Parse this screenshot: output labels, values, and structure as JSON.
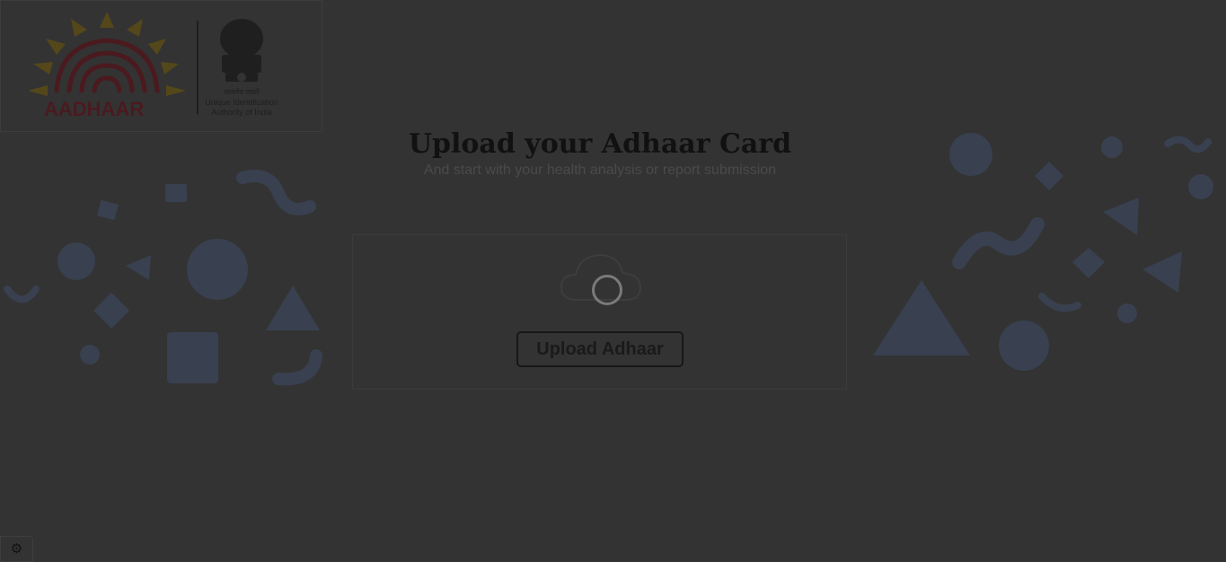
{
  "logo": {
    "brand_text": "AADHAAR",
    "emblem_hindi": "सत्यमेव जयते",
    "authority_line1": "Unique Identification",
    "authority_line2": "Authority of India"
  },
  "hero": {
    "title": "Upload your Adhaar Card",
    "subtitle": "And start with your health analysis or report submission"
  },
  "upload": {
    "button_label": "Upload Adhaar",
    "icons": [
      "cloud-upload-icon",
      "loading-spinner-icon"
    ]
  },
  "settings": {
    "icon": "gear-icon",
    "glyph": "⚙"
  },
  "theme": {
    "overlay": "#333333",
    "decor": "#3a4050",
    "title": "#111111"
  }
}
